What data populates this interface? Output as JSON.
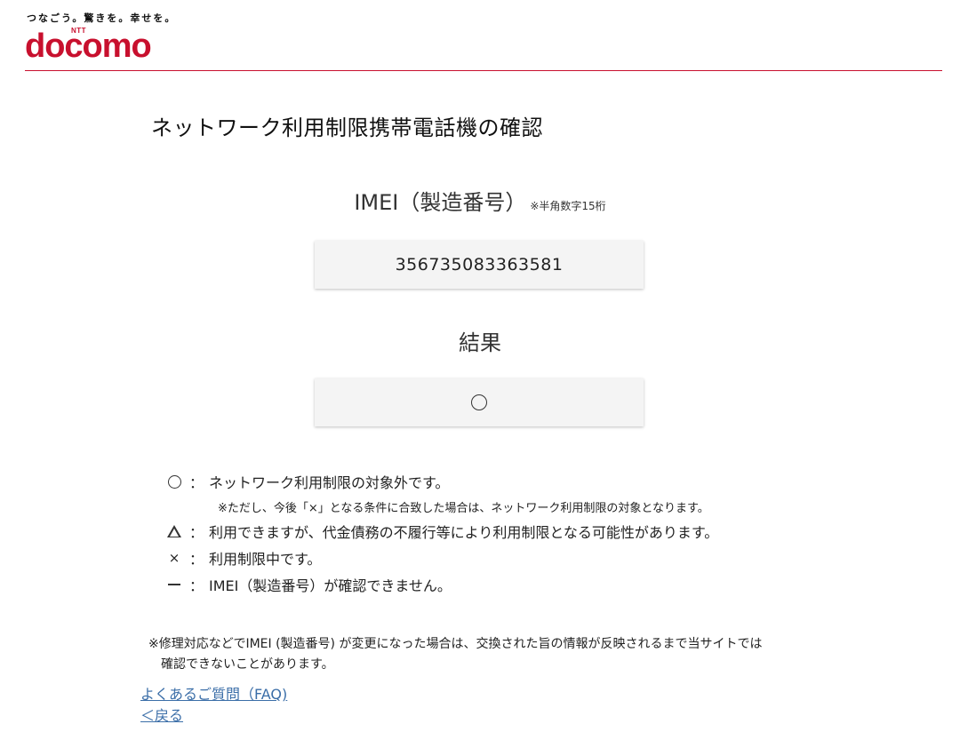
{
  "header": {
    "tagline": "つなごう。驚きを。幸せを。",
    "logo_ntt": "NTT",
    "logo_word": "docomo",
    "brand_color": "#c8102e"
  },
  "page_title": "ネットワーク利用制限携帯電話機の確認",
  "imei": {
    "label": "IMEI（製造番号）",
    "note": "※半角数字15桁",
    "value": "356735083363581"
  },
  "result": {
    "label": "結果",
    "value_icon": "circle-icon"
  },
  "legend": {
    "items": [
      {
        "icon": "circle-icon",
        "colon": "：",
        "text": "ネットワーク利用制限の対象外です。"
      },
      {
        "icon": "triangle-icon",
        "colon": "：",
        "text": "利用できますが、代金債務の不履行等により利用制限となる可能性があります。"
      },
      {
        "icon": "x-icon",
        "symbol": "×",
        "colon": "：",
        "text": "利用制限中です。"
      },
      {
        "icon": "dash-icon",
        "colon": "：",
        "text": "IMEI（製造番号）が確認できません。"
      }
    ],
    "sub_note": "※ただし、今後「×」となる条件に合致した場合は、ネットワーク利用制限の対象となります。"
  },
  "repair_note": {
    "line1": "※修理対応などでIMEI (製造番号) が変更になった場合は、交換された旨の情報が反映されるまで当サイトでは",
    "line2": "確認できないことがあります。"
  },
  "links": {
    "faq": "よくあるご質問（FAQ)",
    "back": "＜戻る"
  }
}
